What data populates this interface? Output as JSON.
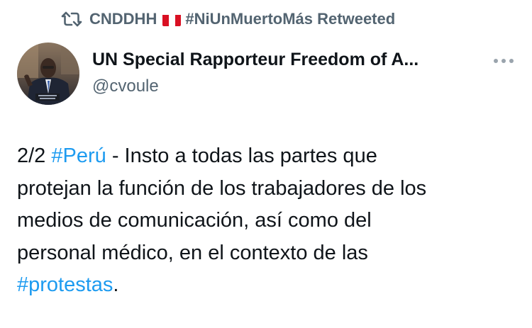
{
  "retweet": {
    "account_name": "CNDDHH",
    "flag_emoji": "🇵🇪",
    "hashtag_name": "#NiUnMuertoMás",
    "suffix": "Retweeted"
  },
  "author": {
    "display_name": "UN Special Rapporteur Freedom of A...",
    "handle": "@cvoule"
  },
  "tweet": {
    "segments": [
      {
        "text": "2/2 ",
        "link": false
      },
      {
        "text": "#Perú",
        "link": true
      },
      {
        "text": " - Insto a todas las partes que ",
        "link": false
      },
      {
        "text": "protejan la función de los trabajadores de los ",
        "link": false
      },
      {
        "text": "medios de comunicación, así como del ",
        "link": false
      },
      {
        "text": "personal médico, en el contexto de las ",
        "link": false
      },
      {
        "text": "#protestas",
        "link": true
      },
      {
        "text": ".",
        "link": false
      }
    ]
  },
  "colors": {
    "link": "#1d9bf0",
    "secondary_text": "#536471",
    "primary_text": "#0f1419"
  },
  "icons": {
    "retweet": "retweet-icon",
    "more": "more-horizontal-icon",
    "flag": "peru-flag-icon"
  }
}
